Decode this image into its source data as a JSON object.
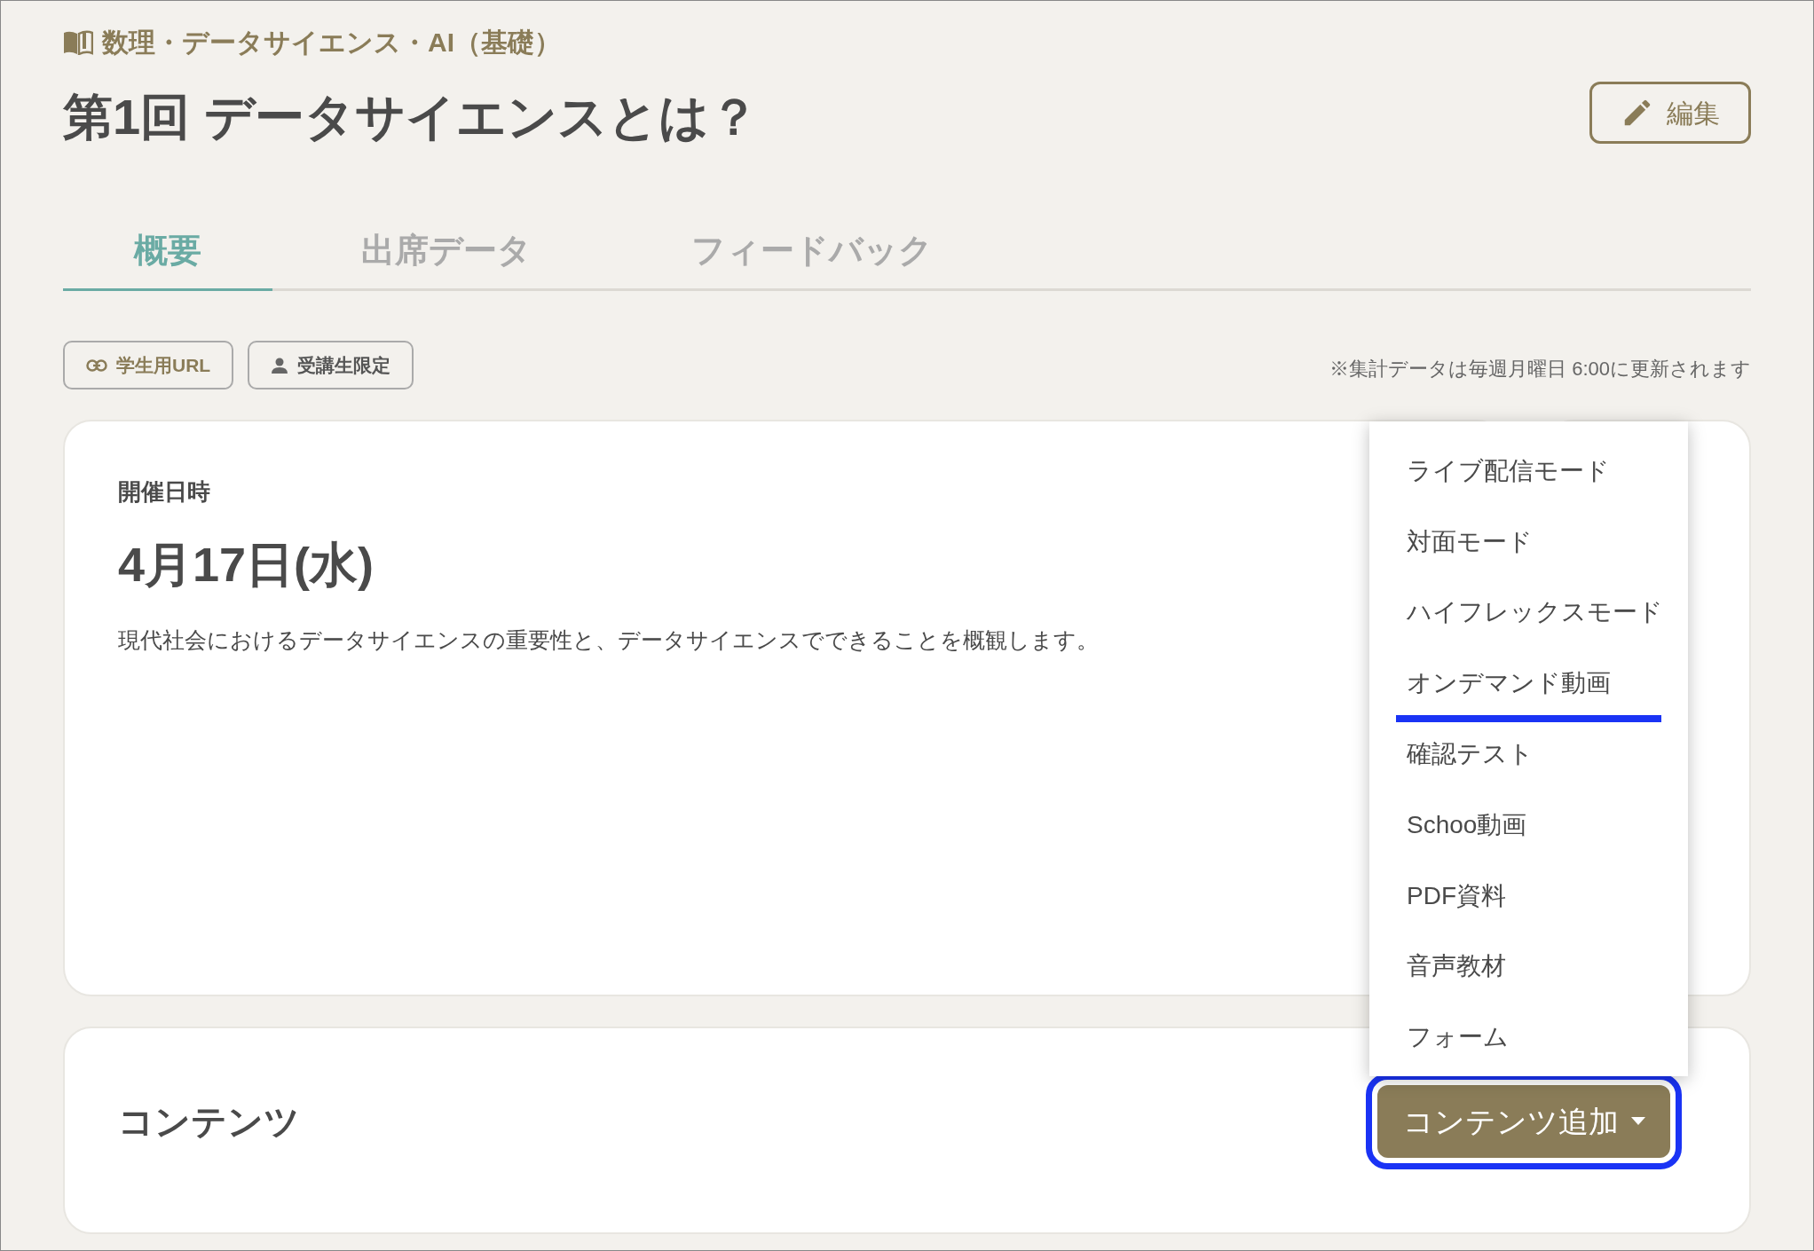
{
  "breadcrumb": "数理・データサイエンス・AI（基礎）",
  "title": "第1回 データサイエンスとは？",
  "edit_button": "編集",
  "tabs": [
    {
      "label": "概要",
      "selected": true
    },
    {
      "label": "出席データ",
      "selected": false
    },
    {
      "label": "フィードバック",
      "selected": false
    }
  ],
  "chips": [
    {
      "label": "学生用URL",
      "kind": "link"
    },
    {
      "label": "受講生限定",
      "kind": "person"
    }
  ],
  "note": "※集計データは毎週月曜日 6:00に更新されます",
  "schedule_card": {
    "label": "開催日時",
    "date": "4月17日(水)",
    "description": "現代社会におけるデータサイエンスの重要性と、データサイエンスでできることを概観します。"
  },
  "contents_card": {
    "heading": "コンテンツ",
    "add_button": {
      "label": "コンテンツ追加",
      "focused": true
    }
  },
  "menu": [
    {
      "label": "ライブ配信モード",
      "selected": false
    },
    {
      "label": "対面モード",
      "selected": false
    },
    {
      "label": "ハイフレックスモード",
      "selected": false
    },
    {
      "label": "オンデマンド動画",
      "selected": true
    },
    {
      "label": "確認テスト",
      "selected": false
    },
    {
      "label": "Schoo動画",
      "selected": false
    },
    {
      "label": "PDF資料",
      "selected": false
    },
    {
      "label": "音声教材",
      "selected": false
    },
    {
      "label": "フォーム",
      "selected": false
    }
  ]
}
